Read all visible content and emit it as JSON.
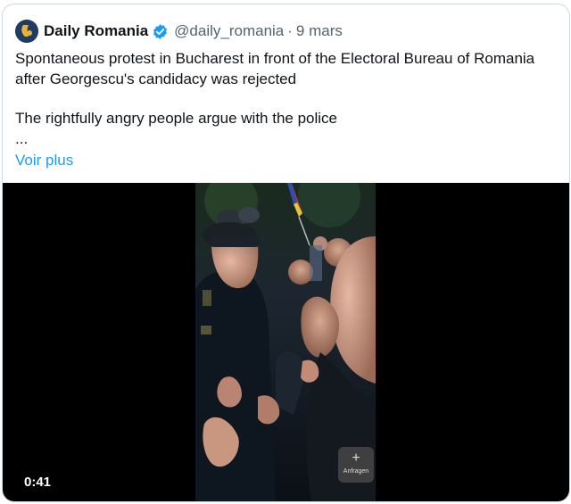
{
  "tweet": {
    "author_name": "Daily Romania",
    "handle": "@daily_romania",
    "separator": "·",
    "date": "9 mars",
    "line1": "Spontaneous protest in Bucharest in front of the Electoral Bureau of Romania",
    "line2": "after Georgescu's candidacy was rejected",
    "line3": "The rightfully angry people argue with the police",
    "ellipsis": "...",
    "more_label": "Voir plus"
  },
  "video": {
    "duration": "0:41",
    "add_icon": "+",
    "add_label": "Anfragen"
  },
  "colors": {
    "accent": "#1d9bf0",
    "text": "#0f1419",
    "muted": "#536471",
    "border": "#cfd9de"
  },
  "icons": [
    "avatar-logo",
    "verified-badge-icon",
    "plus-icon"
  ]
}
